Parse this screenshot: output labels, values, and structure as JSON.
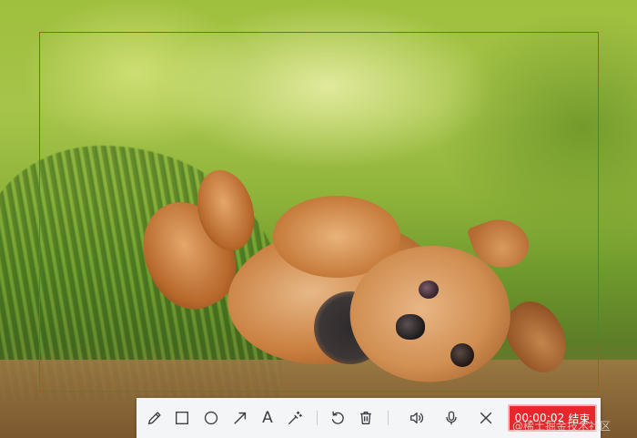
{
  "screen": {
    "description_icon": "photo-of-dog"
  },
  "capture": {
    "border_color": "#e03a2a"
  },
  "toolbar": {
    "tools": [
      {
        "name": "pencil-icon",
        "label": "Pencil"
      },
      {
        "name": "rectangle-icon",
        "label": "Rectangle"
      },
      {
        "name": "ellipse-icon",
        "label": "Ellipse"
      },
      {
        "name": "arrow-icon",
        "label": "Arrow"
      },
      {
        "name": "text-icon",
        "label": "A"
      },
      {
        "name": "mosaic-icon",
        "label": "Mosaic"
      },
      {
        "name": "undo-icon",
        "label": "Undo"
      },
      {
        "name": "trash-icon",
        "label": "Delete"
      },
      {
        "name": "speaker-icon",
        "label": "Sound"
      },
      {
        "name": "microphone-icon",
        "label": "Microphone"
      },
      {
        "name": "close-icon",
        "label": "Close"
      }
    ],
    "text_tool_glyph": "A",
    "timer": "00:00:02",
    "end_label": "结束",
    "accent_color": "#e7272b"
  },
  "watermark": {
    "text": "@稀土掘金技术社区"
  }
}
